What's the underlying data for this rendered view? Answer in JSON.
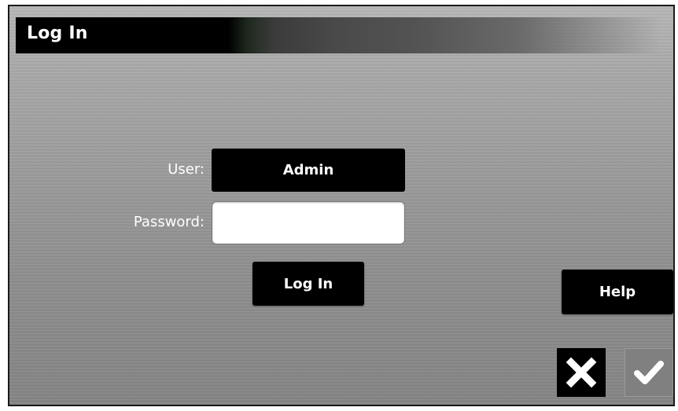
{
  "window": {
    "title": "Log In"
  },
  "form": {
    "user_label": "User:",
    "user_value": "Admin",
    "password_label": "Password:",
    "password_value": ""
  },
  "buttons": {
    "login_label": "Log In",
    "help_label": "Help",
    "cancel_icon": "close-icon",
    "confirm_icon": "checkmark-icon"
  },
  "colors": {
    "panel_bg": "#9a9a9a",
    "button_bg": "#000000",
    "button_text": "#ffffff",
    "confirm_bg": "#808080"
  }
}
